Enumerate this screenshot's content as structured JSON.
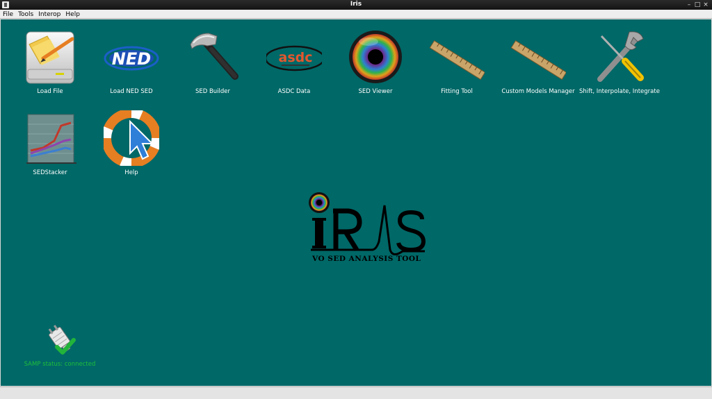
{
  "window": {
    "title": "Iris",
    "controls": [
      "–",
      "□",
      "×"
    ]
  },
  "menu": {
    "items": [
      "File",
      "Tools",
      "Interop",
      "Help"
    ]
  },
  "launchers": [
    {
      "label": "Load File",
      "icon": "load-file-icon"
    },
    {
      "label": "Load NED SED",
      "icon": "ned-icon",
      "icon_text": "NED"
    },
    {
      "label": "SED Builder",
      "icon": "hammer-icon"
    },
    {
      "label": "ASDC Data",
      "icon": "asdc-icon",
      "icon_text": "asdc"
    },
    {
      "label": "SED Viewer",
      "icon": "eye-icon"
    },
    {
      "label": "Fitting Tool",
      "icon": "ruler-icon"
    },
    {
      "label": "Custom Models Manager",
      "icon": "ruler-icon"
    },
    {
      "label": "Shift, Interpolate, Integrate",
      "icon": "tools-icon"
    },
    {
      "label": "SEDStacker",
      "icon": "chart-icon"
    },
    {
      "label": "Help",
      "icon": "lifebuoy-icon"
    }
  ],
  "logo": {
    "tagline": "VO SED ANALYSIS TOOL"
  },
  "samp": {
    "status": "SAMP status: connected",
    "icon": "plug-connected-icon"
  },
  "colors": {
    "desktop": "#006867",
    "samp_green": "#1fbf3a",
    "titlebar": "#1e1e1e"
  }
}
